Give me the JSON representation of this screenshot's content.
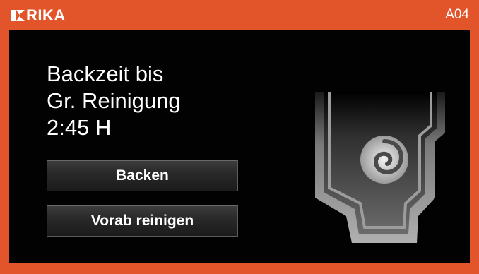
{
  "header": {
    "brand": "RIKA",
    "code": "A04"
  },
  "message": {
    "line1": "Backzeit bis",
    "line2": "Gr. Reinigung",
    "line3": "2:45 H"
  },
  "buttons": {
    "bake_label": "Backen",
    "preclean_label": "Vorab reinigen"
  },
  "colors": {
    "frame": "#e25429",
    "screen": "#020202",
    "button_border": "#5c5c5c",
    "stove_metal": "#9a9a9a"
  },
  "icons": {
    "logo": "rika-logo-mark",
    "stove": "stove-cleaning-icon"
  }
}
